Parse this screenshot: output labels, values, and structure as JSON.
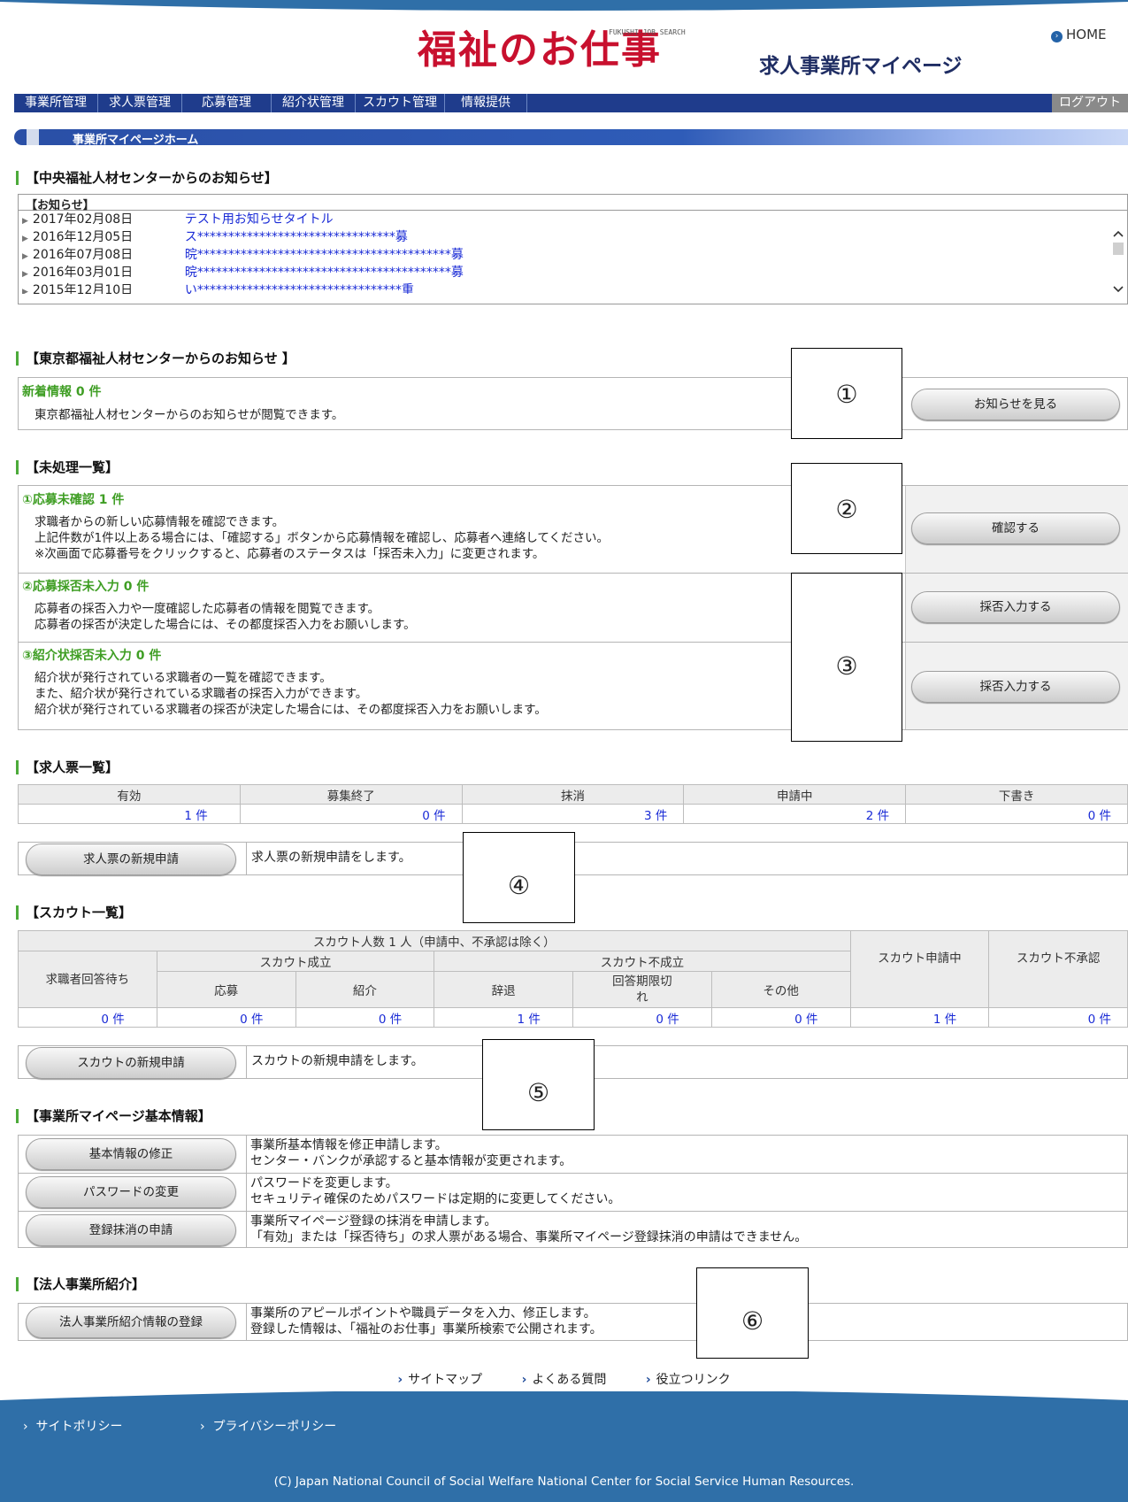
{
  "header": {
    "logo": "福祉のお仕事",
    "logo_sub": "FUKUSHI-JOB SEARCH",
    "page_subtitle": "求人事業所マイページ",
    "home": "HOME"
  },
  "nav": {
    "items": [
      "事業所管理",
      "求人票管理",
      "応募管理",
      "紹介状管理",
      "スカウト管理",
      "情報提供"
    ],
    "logout": "ログアウト"
  },
  "breadcrumb": "事業所マイページホーム",
  "central_notice": {
    "title": "【中央福祉人材センターからのお知らせ】",
    "header": "【お知らせ】",
    "items": [
      {
        "date": "2017年02月08日",
        "title": "テスト用お知らせタイトル"
      },
      {
        "date": "2016年12月05日",
        "title": "ス********************************募"
      },
      {
        "date": "2016年07月08日",
        "title": "晥*****************************************募"
      },
      {
        "date": "2016年03月01日",
        "title": "晥*****************************************募"
      },
      {
        "date": "2015年12月10日",
        "title": "い*********************************重"
      }
    ]
  },
  "tokyo_notice": {
    "title": "【東京都福祉人材センターからのお知らせ 】",
    "new_label": "新着情報 0 件",
    "desc": "東京都福祉人材センターからのお知らせが閲覧できます。",
    "button": "お知らせを見る"
  },
  "pending": {
    "title": "【未処理一覧】",
    "items": [
      {
        "label": "①応募未確認 1 件",
        "lines": [
          "求職者からの新しい応募情報を確認できます。",
          "上記件数が1件以上ある場合には、「確認する」ボタンから応募情報を確認し、応募者へ連絡してください。",
          "※次画面で応募番号をクリックすると、応募者のステータスは「採否未入力」に変更されます。"
        ],
        "button": "確認する"
      },
      {
        "label": "②応募採否未入力 0 件",
        "lines": [
          "応募者の採否入力や一度確認した応募者の情報を閲覧できます。",
          "応募者の採否が決定した場合には、その都度採否入力をお願いします。"
        ],
        "button": "採否入力する"
      },
      {
        "label": "③紹介状採否未入力 0 件",
        "lines": [
          "紹介状が発行されている求職者の一覧を確認できます。",
          "また、紹介状が発行されている求職者の採否入力ができます。",
          "紹介状が発行されている求職者の採否が決定した場合には、その都度採否入力をお願いします。"
        ],
        "button": "採否入力する"
      }
    ]
  },
  "jobs": {
    "title": "【求人票一覧】",
    "headers": [
      "有効",
      "募集終了",
      "抹消",
      "申請中",
      "下書き"
    ],
    "values": [
      "1 件",
      "0 件",
      "3 件",
      "2 件",
      "0 件"
    ],
    "new_button": "求人票の新規申請",
    "new_desc": "求人票の新規申請をします。"
  },
  "scout": {
    "title": "【スカウト一覧】",
    "total": "スカウト人数 1 人（申請中、不承認は除く）",
    "waiting": "求職者回答待ち",
    "success": "スカウト成立",
    "fail": "スカウト不成立",
    "applying": "スカウト申請中",
    "rejected": "スカウト不承認",
    "sub_headers": [
      "応募",
      "紹介",
      "辞退",
      "回答期限切れ",
      "その他"
    ],
    "values": [
      "0 件",
      "0 件",
      "0 件",
      "1 件",
      "0 件",
      "0 件",
      "1 件",
      "0 件"
    ],
    "new_button": "スカウトの新規申請",
    "new_desc": "スカウトの新規申請をします。"
  },
  "basic": {
    "title": "【事業所マイページ基本情報】",
    "rows": [
      {
        "button": "基本情報の修正",
        "lines": [
          "事業所基本情報を修正申請します。",
          "センター・バンクが承認すると基本情報が変更されます。"
        ]
      },
      {
        "button": "パスワードの変更",
        "lines": [
          "パスワードを変更します。",
          "セキュリティ確保のためパスワードは定期的に変更してください。"
        ]
      },
      {
        "button": "登録抹消の申請",
        "lines": [
          "事業所マイページ登録の抹消を申請します。",
          "「有効」または「採否待ち」の求人票がある場合、事業所マイページ登録抹消の申請はできません。"
        ]
      }
    ]
  },
  "corp": {
    "title": "【法人事業所紹介】",
    "button": "法人事業所紹介情報の登録",
    "lines": [
      "事業所のアピールポイントや職員データを入力、修正します。",
      "登録した情報は、「福祉のお仕事」事業所検索で公開されます。"
    ]
  },
  "annotations": [
    "①",
    "②",
    "③",
    "④",
    "⑤",
    "⑥"
  ],
  "footer": {
    "links": [
      "サイトマップ",
      "よくある質問",
      "役立つリンク"
    ],
    "policies": [
      "サイトポリシー",
      "プライバシーポリシー"
    ],
    "copyright": "(C) Japan National Council of Social Welfare National Center for Social Service Human Resources."
  },
  "colors": {
    "nav": "#1f3c8c",
    "accent_green": "#3f9e24",
    "footer": "#2f6fa8",
    "link": "#1a2bd6"
  }
}
